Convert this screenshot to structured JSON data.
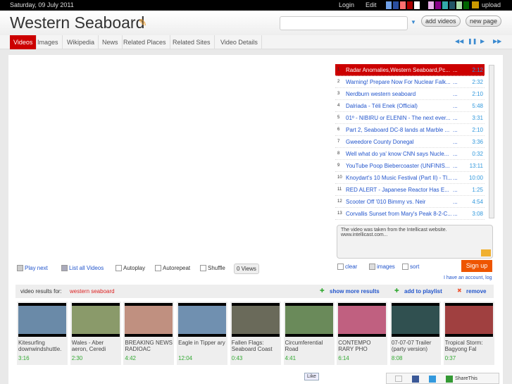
{
  "topbar": {
    "date": "Saturday, 09 July 2011",
    "login": "Login",
    "edit": "Edit",
    "upload": "upload",
    "swatches": [
      "#6fa0e8",
      "#2a4fa0",
      "#ff7070",
      "#aa0000",
      "#ffffff",
      "#000000",
      "#e8b0e8",
      "#880088",
      "#33aaaa",
      "#225566",
      "#aaddaa",
      "#006600"
    ]
  },
  "header": {
    "title": "Western Seaboard",
    "search_value": "",
    "add_videos": "add videos",
    "new_page": "new page"
  },
  "tabs": [
    {
      "label": "Videos",
      "active": true
    },
    {
      "label": "Images"
    },
    {
      "label": "Wikipedia"
    },
    {
      "label": "News"
    },
    {
      "label": "Related Places"
    },
    {
      "label": "Related Sites"
    },
    {
      "label": "Video Details"
    }
  ],
  "player_controls": [
    "rewind-icon",
    "pause-icon",
    "play-icon",
    "fast-forward-icon"
  ],
  "playlist": [
    {
      "n": "1",
      "title": "Radar Anomalies,Western Seaboard,Pc...",
      "dur": "2:12",
      "active": true
    },
    {
      "n": "2",
      "title": "Warning! Prepare Now For Nuclear Falk...",
      "dur": "2:32"
    },
    {
      "n": "3",
      "title": "Nerdburn western seaboard",
      "dur": "2:10"
    },
    {
      "n": "4",
      "title": "Dalriada - Téli Enek (Official)",
      "dur": "5:48"
    },
    {
      "n": "5",
      "title": "01º - NIBIRU or ELENIN - The next ever...",
      "dur": "3:31"
    },
    {
      "n": "6",
      "title": "Part 2, Seaboard DC-8 lands at Marble ...",
      "dur": "2:10"
    },
    {
      "n": "7",
      "title": "Gweedore County Donegal",
      "dur": "3:36"
    },
    {
      "n": "8",
      "title": "Well what do ya' know CNN says Nucle...",
      "dur": "0:32"
    },
    {
      "n": "9",
      "title": "YouTube Poop Biebercoaster (UNFINIS...",
      "dur": "13:11"
    },
    {
      "n": "10",
      "title": "Knoydart's 10 Music Festival (Part II) - Tl...",
      "dur": "10:00"
    },
    {
      "n": "11",
      "title": "RED ALERT - Japanese Reactor Has E...",
      "dur": "1:25"
    },
    {
      "n": "12",
      "title": "Scooter Off '010 Bimmy vs. Neir",
      "dur": "4:54"
    },
    {
      "n": "13",
      "title": "Corvallis Sunset from Mary's Peak 8-2-C...",
      "dur": "3:08"
    }
  ],
  "ellipsis": "...",
  "description": "The video was taken from the Intellicast website. www.intellicast.com...",
  "options": {
    "play_next": "Play next",
    "list_all": "List all Videos",
    "autoplay": "Autoplay",
    "autorepeat": "Autorepeat",
    "shuffle": "Shuffle",
    "views": "0 Views",
    "clear": "clear",
    "images": "images",
    "sort": "sort",
    "signup": "Sign up",
    "account": "I have an account, log"
  },
  "results": {
    "label": "video results for:",
    "query": "western seaboard",
    "show_more": "show more results",
    "add_playlist": "add to playlist",
    "remove": "remove"
  },
  "thumbs": [
    {
      "title": "Kitesurfing downwindshuttle.",
      "dur": "3:16",
      "c": "#6a8aa8"
    },
    {
      "title": "Wales - Aber aeron, Ceredi",
      "dur": "2:30",
      "c": "#8a9a6a"
    },
    {
      "title": "BREAKING NEWS RADIOAC",
      "dur": "4:42",
      "c": "#c09080"
    },
    {
      "title": "Eagle in Tipper ary",
      "dur": "12:04",
      "c": "#7090b0"
    },
    {
      "title": "Fallen Flags: Seaboard Coast",
      "dur": "0:43",
      "c": "#6a6a5a"
    },
    {
      "title": "Circumferential Road",
      "dur": "4:41",
      "c": "#6a8a5a"
    },
    {
      "title": "CONTEMPO RARY PHO",
      "dur": "6:14",
      "c": "#c06080"
    },
    {
      "title": "07-07-07 Trailer (party version)",
      "dur": "8:08",
      "c": "#305050"
    },
    {
      "title": "Tropical Storm: Bagyong Fal",
      "dur": "0:37",
      "c": "#a04040"
    }
  ],
  "social": {
    "like": "Like",
    "share": "ShareThis"
  }
}
